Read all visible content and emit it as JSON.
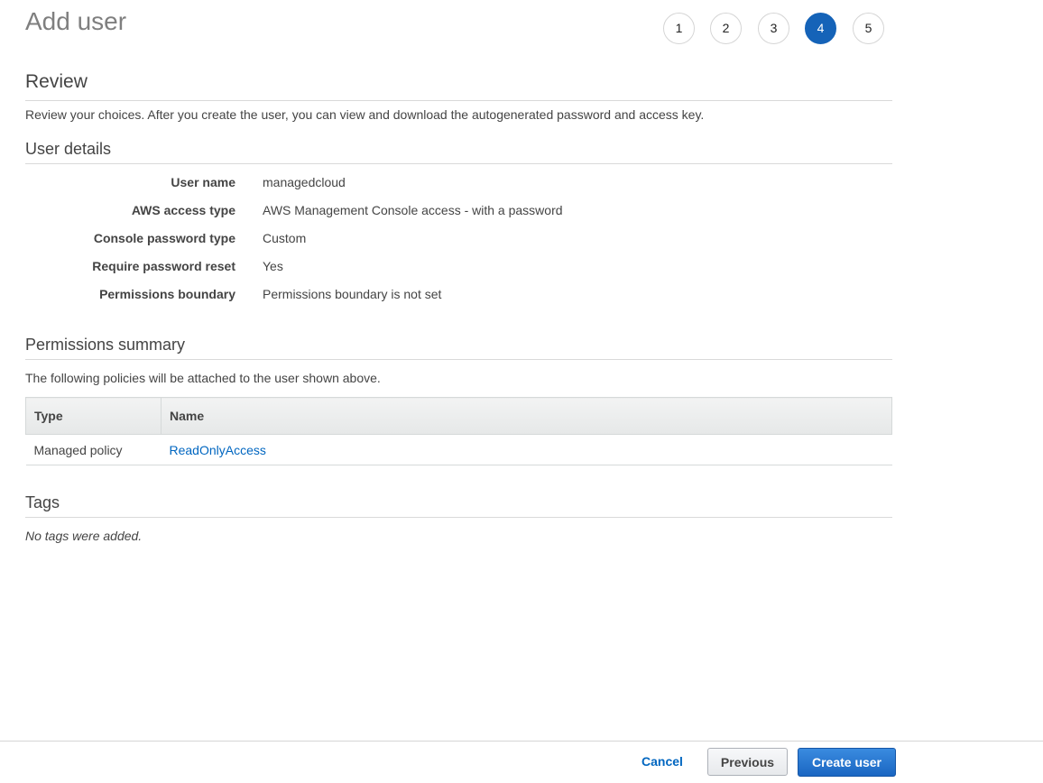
{
  "page": {
    "title": "Add user"
  },
  "stepper": {
    "steps": [
      "1",
      "2",
      "3",
      "4",
      "5"
    ],
    "active_step": "4",
    "active_color": "#1563b8"
  },
  "review": {
    "heading": "Review",
    "description": "Review your choices. After you create the user, you can view and download the autogenerated password and access key."
  },
  "user_details": {
    "heading": "User details",
    "rows": [
      {
        "label": "User name",
        "value": "managedcloud"
      },
      {
        "label": "AWS access type",
        "value": "AWS Management Console access - with a password"
      },
      {
        "label": "Console password type",
        "value": "Custom"
      },
      {
        "label": "Require password reset",
        "value": "Yes"
      },
      {
        "label": "Permissions boundary",
        "value": "Permissions boundary is not set"
      }
    ]
  },
  "permissions_summary": {
    "heading": "Permissions summary",
    "description": "The following policies will be attached to the user shown above.",
    "columns": [
      "Type",
      "Name"
    ],
    "rows": [
      {
        "type": "Managed policy",
        "name": "ReadOnlyAccess"
      }
    ]
  },
  "tags": {
    "heading": "Tags",
    "empty_text": "No tags were added."
  },
  "footer": {
    "cancel_label": "Cancel",
    "previous_label": "Previous",
    "create_label": "Create user",
    "primary_color": "#1a66c2",
    "link_color": "#0066c0"
  }
}
